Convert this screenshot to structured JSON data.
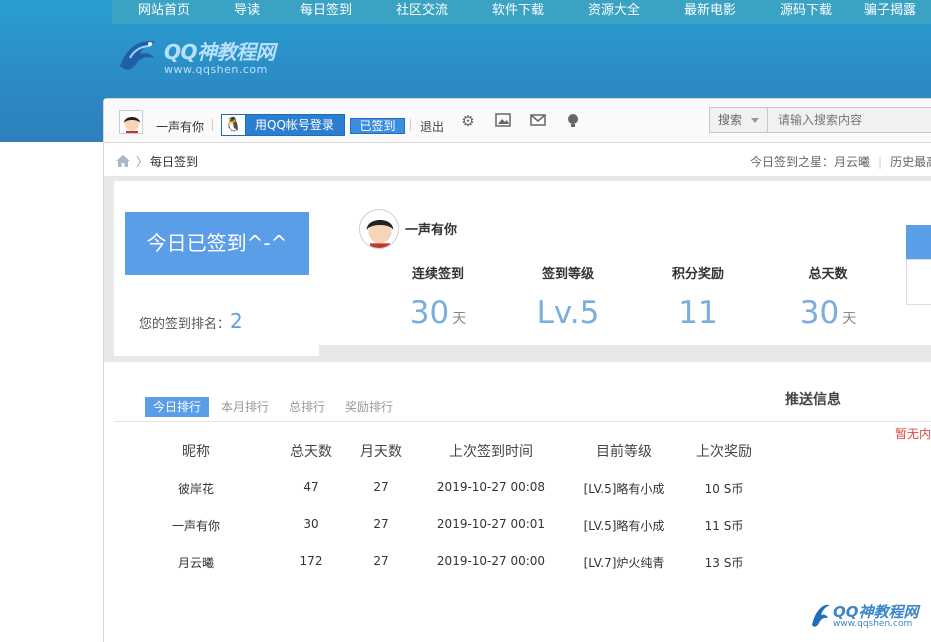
{
  "nav": [
    "网站首页",
    "导读",
    "每日签到",
    "社区交流",
    "软件下载",
    "资源大全",
    "最新电影",
    "源码下载",
    "骗子揭露"
  ],
  "logo": {
    "text": "QQ神教程网",
    "sub": "www.qqshen.com"
  },
  "toolbar": {
    "username": "一声有你",
    "qq_login": "用QQ帐号登录",
    "signed": "已签到",
    "logout": "退出",
    "icons": [
      "gear-icon",
      "image-icon",
      "mail-icon",
      "bulb-icon"
    ],
    "search_select": "搜索",
    "search_placeholder": "请输入搜索内容"
  },
  "breadcrumb": {
    "current": "每日签到",
    "star_label": "今日签到之星：月云曦",
    "history": "历史最高"
  },
  "sign": {
    "button": "今日已签到^-^",
    "rank_label": "您的签到排名：",
    "rank": "2"
  },
  "profile": {
    "name": "一声有你",
    "stats": [
      {
        "label": "连续签到",
        "value": "30",
        "unit": "天"
      },
      {
        "label": "签到等级",
        "value": "Lv.5",
        "unit": ""
      },
      {
        "label": "积分奖励",
        "value": "11",
        "unit": ""
      },
      {
        "label": "总天数",
        "value": "30",
        "unit": "天"
      }
    ]
  },
  "ranking": {
    "tabs": [
      "今日排行",
      "本月排行",
      "总排行",
      "奖励排行"
    ],
    "active_tab": "今日排行",
    "columns": [
      "昵称",
      "总天数",
      "月天数",
      "上次签到时间",
      "目前等级",
      "上次奖励"
    ],
    "rows": [
      [
        "彼岸花",
        "47",
        "27",
        "2019-10-27 00:08",
        "[LV.5]略有小成",
        "10 S币"
      ],
      [
        "一声有你",
        "30",
        "27",
        "2019-10-27 00:01",
        "[LV.5]略有小成",
        "11 S币"
      ],
      [
        "月云曦",
        "172",
        "27",
        "2019-10-27 00:00",
        "[LV.7]炉火纯青",
        "13 S币"
      ]
    ]
  },
  "push": {
    "title": "推送信息",
    "empty": "暂无内"
  },
  "watermark": {
    "text": "QQ神教程网",
    "sub": "www.qqshen.com"
  },
  "colors": {
    "accent": "#5b9ee8",
    "banner": "#2b8fc6",
    "nav": "#3aa3c4"
  }
}
